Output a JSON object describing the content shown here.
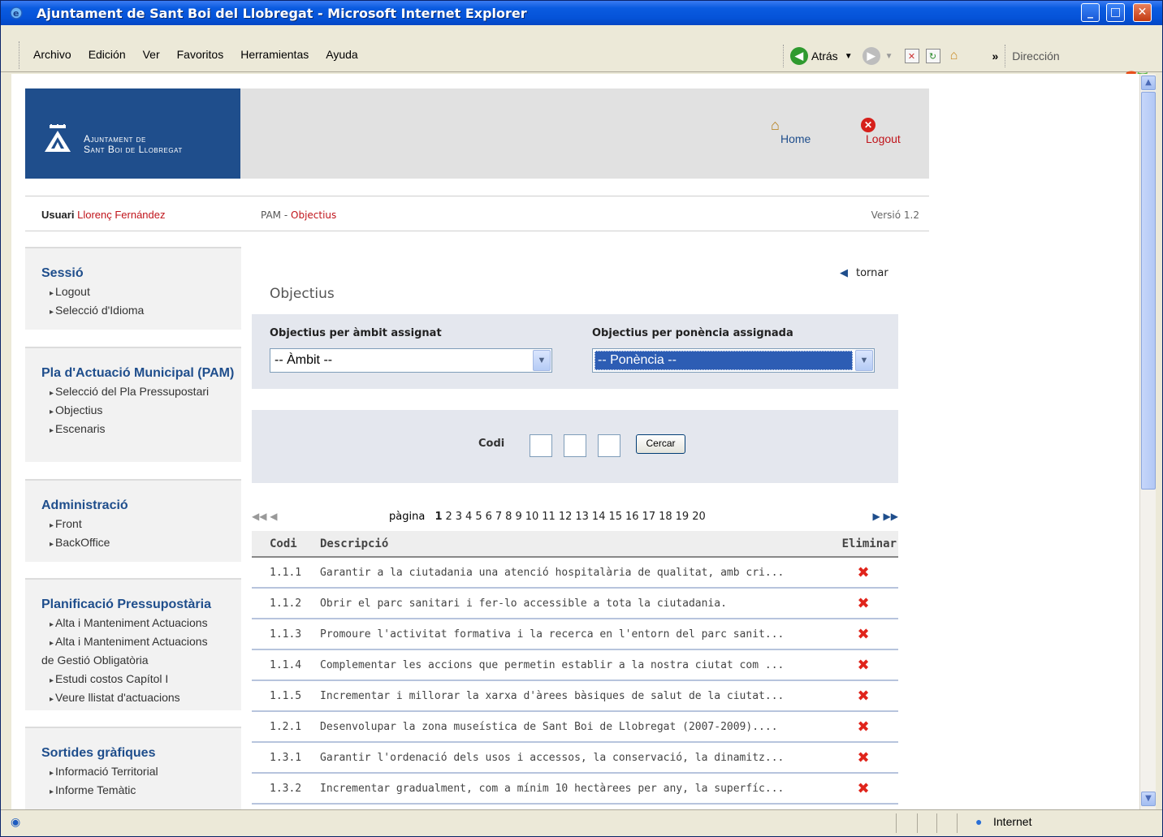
{
  "window": {
    "title": "Ajuntament de Sant Boi del Llobregat - Microsoft Internet Explorer",
    "menu": [
      "Archivo",
      "Edición",
      "Ver",
      "Favoritos",
      "Herramientas",
      "Ayuda"
    ],
    "back_label": "Atrás",
    "address_label": "Dirección",
    "status_zone": "Internet"
  },
  "header": {
    "logo_line1": "Ajuntament de",
    "logo_line2": "Sant Boi de Llobregat",
    "home_label": "Home",
    "logout_label": "Logout"
  },
  "userbar": {
    "user_label": "Usuari",
    "user_name": "Llorenç Fernández",
    "crumb_root": "PAM",
    "crumb_sep": " - ",
    "crumb_current": "Objectius",
    "version": "Versió 1.2"
  },
  "sidebar": {
    "sessio": {
      "title": "Sessió",
      "items": [
        "Logout",
        "Selecció d'Idioma"
      ]
    },
    "pam": {
      "title": "Pla d'Actuació Municipal (PAM)",
      "items": [
        "Selecció del Pla Pressupostari",
        "Objectius",
        "Escenaris"
      ]
    },
    "admin": {
      "title": "Administració",
      "items": [
        "Front",
        "BackOffice"
      ]
    },
    "planif": {
      "title": "Planificació Pressupostària",
      "items": [
        "Alta i Manteniment Actuacions",
        "Alta i Manteniment Actuacions",
        "de Gestió Obligatòria",
        "Estudi costos Capítol I",
        "Veure llistat d'actuacions"
      ]
    },
    "sortides": {
      "title": "Sortides gràfiques",
      "items": [
        "Informació Territorial",
        "Informe Temàtic"
      ]
    }
  },
  "main": {
    "back_link": "tornar",
    "title": "Objectius",
    "filter_ambit_label": "Objectius per àmbit assignat",
    "filter_ambit_value": "-- Àmbit --",
    "filter_ponencia_label": "Objectius per ponència assignada",
    "filter_ponencia_value": "-- Ponència --",
    "codi_label": "Codi",
    "search_button": "Cercar",
    "pager_label": "pàgina",
    "pages": [
      "1",
      "2",
      "3",
      "4",
      "5",
      "6",
      "7",
      "8",
      "9",
      "10",
      "11",
      "12",
      "13",
      "14",
      "15",
      "16",
      "17",
      "18",
      "19",
      "20"
    ],
    "current_page": "1",
    "table_headers": {
      "codi": "Codi",
      "descripcio": "Descripció",
      "eliminar": "Eliminar"
    },
    "rows": [
      {
        "codi": "1.1.1",
        "descripcio": "Garantir a la ciutadania una atenció hospitalària de qualitat, amb cri..."
      },
      {
        "codi": "1.1.2",
        "descripcio": "Obrir el parc sanitari i fer-lo accessible a tota la ciutadania."
      },
      {
        "codi": "1.1.3",
        "descripcio": "Promoure l'activitat formativa i la recerca en l'entorn del parc sanit..."
      },
      {
        "codi": "1.1.4",
        "descripcio": "Complementar les accions que permetin establir a la nostra ciutat com ..."
      },
      {
        "codi": "1.1.5",
        "descripcio": "Incrementar i millorar la xarxa d'àrees bàsiques de salut de la ciutat..."
      },
      {
        "codi": "1.2.1",
        "descripcio": "Desenvolupar la zona museística de Sant Boi de Llobregat (2007-2009)...."
      },
      {
        "codi": "1.3.1",
        "descripcio": "Garantir l'ordenació dels usos i accessos, la conservació, la dinamitz..."
      },
      {
        "codi": "1.3.2",
        "descripcio": "Incrementar gradualment, com a mínim 10 hectàrees per any, la superfíc..."
      }
    ],
    "delete_glyph": "✖"
  },
  "icons": {
    "delete": "delete-icon",
    "home": "home-icon",
    "logout": "logout-icon"
  }
}
